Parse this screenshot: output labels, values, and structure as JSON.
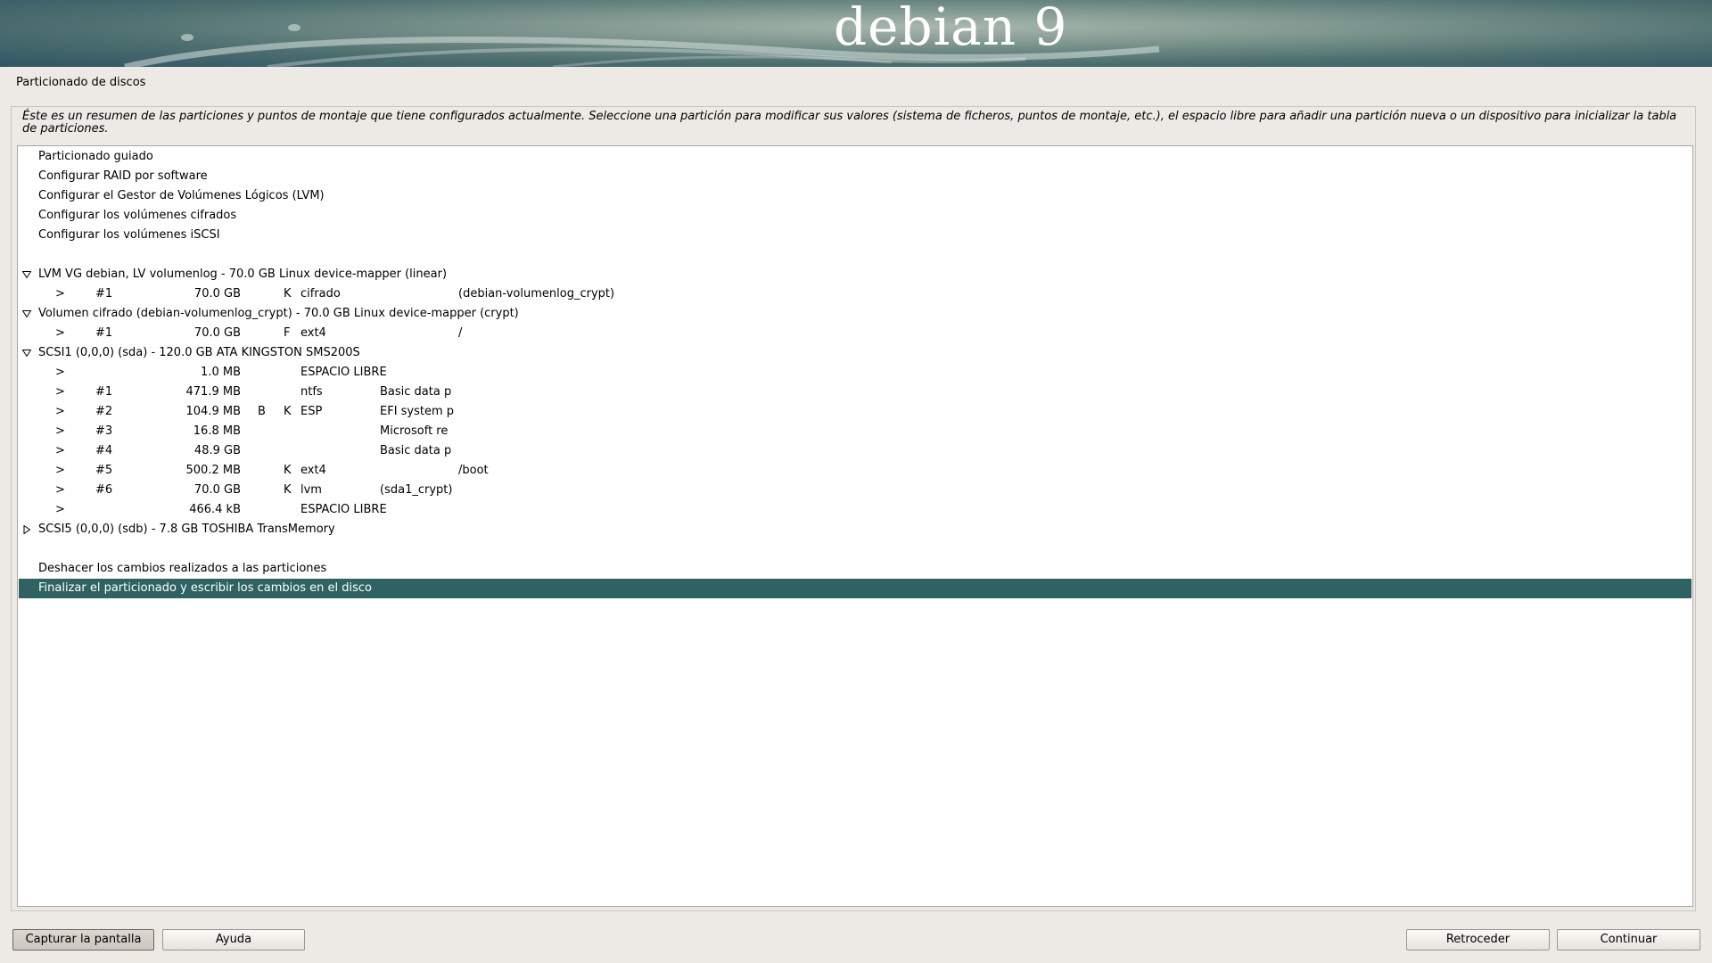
{
  "banner": {
    "title": "debian 9"
  },
  "page_title": "Particionado de discos",
  "intro_text": "Éste es un resumen de las particiones y puntos de montaje que tiene configurados actualmente. Seleccione una partición para modificar sus valores (sistema de ficheros, puntos de montaje, etc.), el espacio libre para añadir una partición nueva o un dispositivo para inicializar la tabla de particiones.",
  "menu": [
    "Particionado guiado",
    "Configurar RAID por software",
    "Configurar el Gestor de Volúmenes Lógicos (LVM)",
    "Configurar los volúmenes cifrados",
    "Configurar los volúmenes iSCSI"
  ],
  "devices": [
    {
      "label": "LVM VG debian, LV volumenlog - 70.0 GB Linux device-mapper (linear)",
      "expanded": true,
      "partitions": [
        {
          "arrow": ">",
          "num": "#1",
          "size": "70.0 GB",
          "bflag": "",
          "kflag": "K",
          "fs": "cifrado",
          "name": "",
          "mount": "(debian-volumenlog_crypt)"
        }
      ]
    },
    {
      "label": "Volumen cifrado (debian-volumenlog_crypt) - 70.0 GB Linux device-mapper (crypt)",
      "expanded": true,
      "partitions": [
        {
          "arrow": ">",
          "num": "#1",
          "size": "70.0 GB",
          "bflag": "",
          "kflag": "F",
          "fs": "ext4",
          "name": "",
          "mount": "/"
        }
      ]
    },
    {
      "label": "SCSI1 (0,0,0) (sda) - 120.0 GB ATA KINGSTON SMS200S",
      "expanded": true,
      "partitions": [
        {
          "arrow": ">",
          "num": "",
          "size": "1.0 MB",
          "bflag": "",
          "kflag": "",
          "fs": "ESPACIO LIBRE",
          "name": "",
          "mount": ""
        },
        {
          "arrow": ">",
          "num": "#1",
          "size": "471.9 MB",
          "bflag": "",
          "kflag": "",
          "fs": "ntfs",
          "name": "Basic data p",
          "mount": ""
        },
        {
          "arrow": ">",
          "num": "#2",
          "size": "104.9 MB",
          "bflag": "B",
          "kflag": "K",
          "fs": "ESP",
          "name": "EFI system p",
          "mount": ""
        },
        {
          "arrow": ">",
          "num": "#3",
          "size": "16.8 MB",
          "bflag": "",
          "kflag": "",
          "fs": "",
          "name": "Microsoft re",
          "mount": ""
        },
        {
          "arrow": ">",
          "num": "#4",
          "size": "48.9 GB",
          "bflag": "",
          "kflag": "",
          "fs": "",
          "name": "Basic data p",
          "mount": ""
        },
        {
          "arrow": ">",
          "num": "#5",
          "size": "500.2 MB",
          "bflag": "",
          "kflag": "K",
          "fs": "ext4",
          "name": "",
          "mount": "/boot"
        },
        {
          "arrow": ">",
          "num": "#6",
          "size": "70.0 GB",
          "bflag": "",
          "kflag": "K",
          "fs": "lvm",
          "name": "(sda1_crypt)",
          "mount": ""
        },
        {
          "arrow": ">",
          "num": "",
          "size": "466.4 kB",
          "bflag": "",
          "kflag": "",
          "fs": "ESPACIO LIBRE",
          "name": "",
          "mount": ""
        }
      ]
    },
    {
      "label": "SCSI5 (0,0,0) (sdb) - 7.8 GB TOSHIBA TransMemory",
      "expanded": false,
      "partitions": []
    }
  ],
  "actions": [
    {
      "label": "Deshacer los cambios realizados a las particiones",
      "selected": false
    },
    {
      "label": "Finalizar el particionado y escribir los cambios en el disco",
      "selected": true
    }
  ],
  "buttons": {
    "screenshot": "Capturar la pantalla",
    "help": "Ayuda",
    "back": "Retroceder",
    "continue": "Continuar"
  },
  "colors": {
    "selection": "#2f6262",
    "background": "#edeae5"
  }
}
